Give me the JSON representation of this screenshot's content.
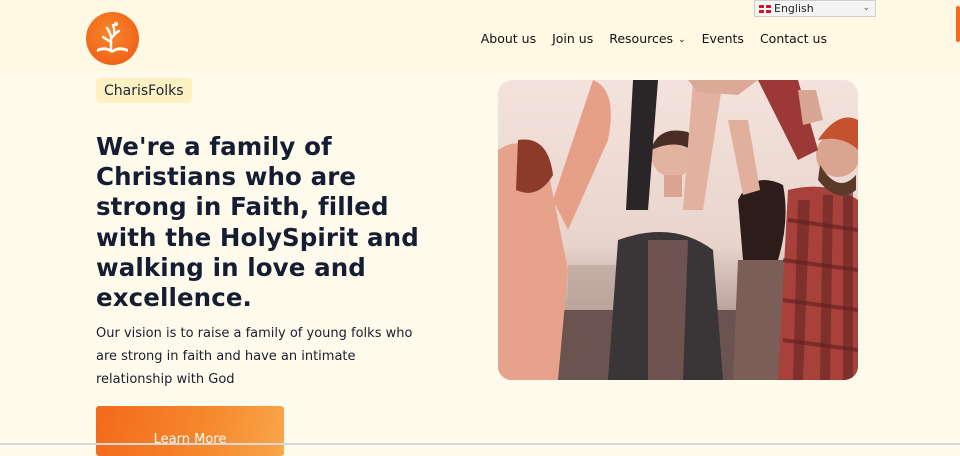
{
  "header": {
    "logo_icon": "tree-book-icon",
    "nav": [
      {
        "label": "About us"
      },
      {
        "label": "Join us"
      },
      {
        "label": "Resources",
        "has_dropdown": true
      },
      {
        "label": "Events"
      },
      {
        "label": "Contact us"
      }
    ],
    "language_select": {
      "value": "English",
      "icon": "uk-flag-icon"
    }
  },
  "hero": {
    "badge": "CharisFolks",
    "headline": "We're a family of Christians who are strong in Faith, filled with the HolySpirit and walking in love and excellence.",
    "vision": "Our vision is to raise a family of young folks who are strong in faith and have an intimate relationship with God",
    "cta": "Learn More",
    "image_alt": "Group of young people raising hands together"
  },
  "colors": {
    "accent": "#f26a1b",
    "background": "#fffbec",
    "header_bg": "#fff8e3",
    "badge_bg": "#fdf1c2",
    "heading": "#151d33"
  }
}
